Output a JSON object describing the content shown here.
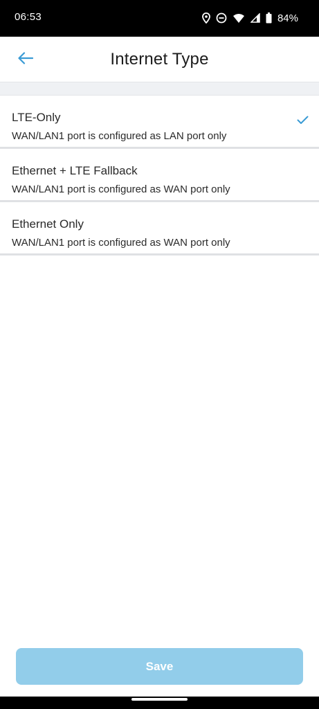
{
  "status_bar": {
    "time": "06:53",
    "battery": "84%",
    "icons": [
      "location-icon",
      "do-not-disturb-icon",
      "wifi-icon",
      "cell-signal-icon",
      "battery-icon"
    ]
  },
  "header": {
    "title": "Internet Type",
    "back_icon": "back-arrow-icon"
  },
  "options": [
    {
      "title": "LTE-Only",
      "description": "WAN/LAN1 port is configured as LAN port only",
      "selected": true
    },
    {
      "title": "Ethernet + LTE Fallback",
      "description": "WAN/LAN1 port is configured as WAN port only",
      "selected": false
    },
    {
      "title": "Ethernet Only",
      "description": "WAN/LAN1 port is configured as WAN port only",
      "selected": false
    }
  ],
  "save_button": {
    "label": "Save",
    "enabled": false
  },
  "colors": {
    "accent": "#3a9bd5",
    "save_disabled": "#92cdea",
    "divider": "#dfe1e4",
    "band": "#eff1f4"
  }
}
